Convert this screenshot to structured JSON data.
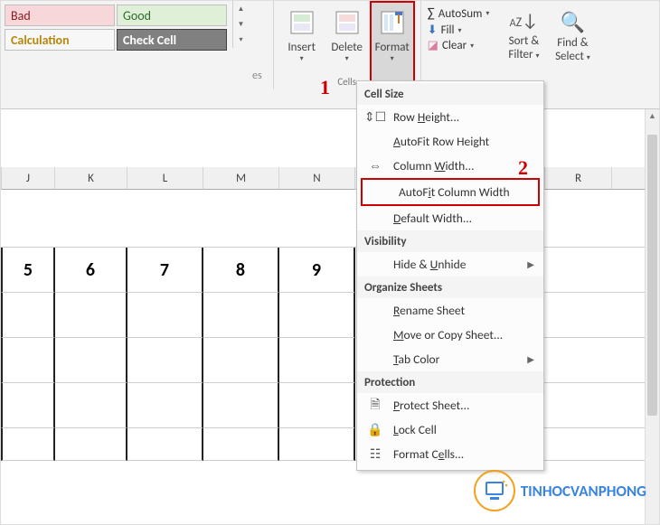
{
  "styles": {
    "bad": "Bad",
    "good": "Good",
    "calc": "Calculation",
    "check": "Check Cell"
  },
  "es_label": "es",
  "cells_group": {
    "insert": "Insert",
    "delete": "Delete",
    "format": "Format",
    "label": "Cells"
  },
  "editing": {
    "autosum": "AutoSum",
    "fill": "Fill",
    "clear": "Clear",
    "sortfilter_l1": "Sort &",
    "sortfilter_l2": "Filter",
    "find_l1": "Find &",
    "find_l2": "Select"
  },
  "annot": {
    "one": "1",
    "two": "2"
  },
  "format_menu": {
    "cellsize_hdr": "Cell Size",
    "row_height": "Row Height...",
    "autofit_row": "AutoFit Row Height",
    "col_width": "Column Width...",
    "autofit_col": "AutoFit Column Width",
    "default_width": "Default Width...",
    "visibility_hdr": "Visibility",
    "hide_unhide": "Hide & Unhide",
    "organize_hdr": "Organize Sheets",
    "rename_sheet": "Rename Sheet",
    "movecopy": "Move or Copy Sheet...",
    "tab_color": "Tab Color",
    "protection_hdr": "Protection",
    "protect_sheet": "Protect Sheet...",
    "lock_cell": "Lock Cell",
    "format_cells": "Format Cells..."
  },
  "columns": [
    "J",
    "K",
    "L",
    "M",
    "N",
    "",
    "",
    "R"
  ],
  "data_row": [
    "5",
    "6",
    "7",
    "8",
    "9"
  ],
  "watermark": "TINHOCVANPHONG"
}
